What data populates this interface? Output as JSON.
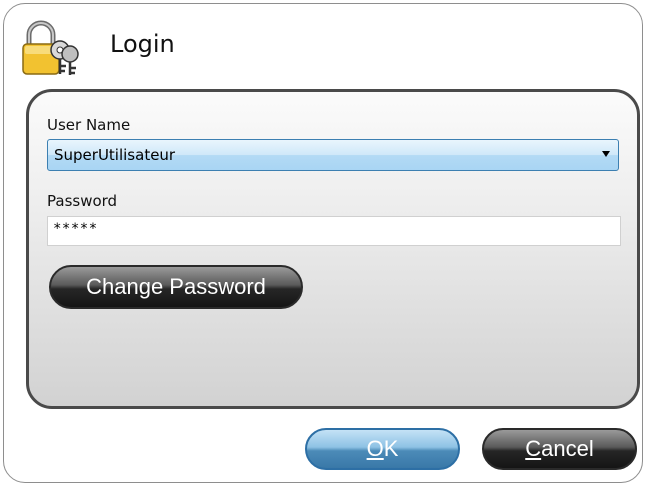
{
  "dialog": {
    "title": "Login",
    "icon": "lock-keys-icon"
  },
  "form": {
    "user_name_label": "User Name",
    "user_name_value": "SuperUtilisateur",
    "password_label": "Password",
    "password_value": "*****",
    "change_password_label": "Change Password"
  },
  "buttons": {
    "ok_mnemonic": "O",
    "ok_rest": "K",
    "cancel_mnemonic": "C",
    "cancel_rest": "ancel"
  },
  "colors": {
    "selected_field": "#b3daf5",
    "ok_button": "#4c8bb8",
    "dark_button": "#262626",
    "panel_border": "#4a4a4a"
  }
}
